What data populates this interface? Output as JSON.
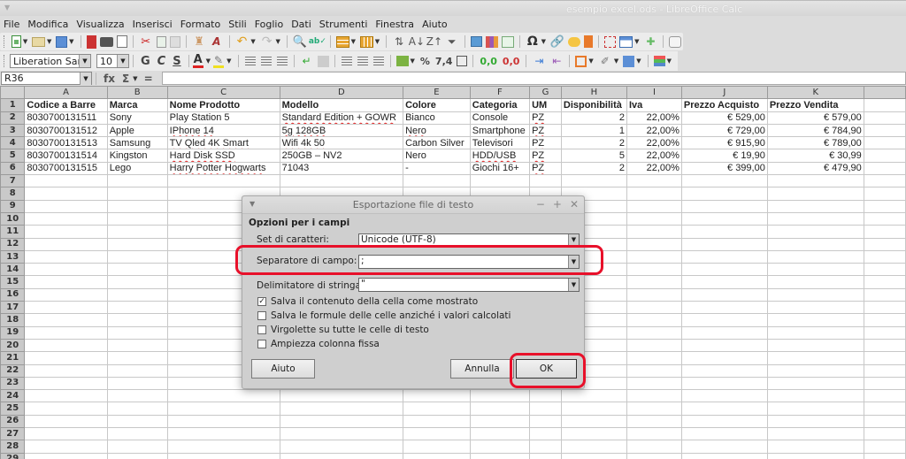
{
  "window": {
    "title": "esempio excel.ods - LibreOffice Calc"
  },
  "menu": [
    {
      "label": "File",
      "key": "F"
    },
    {
      "label": "Modifica",
      "key": "M"
    },
    {
      "label": "Visualizza",
      "key": "V"
    },
    {
      "label": "Inserisci",
      "key": "I"
    },
    {
      "label": "Formato",
      "key": "o"
    },
    {
      "label": "Stili",
      "key": "i"
    },
    {
      "label": "Foglio",
      "key": "F"
    },
    {
      "label": "Dati",
      "key": "D"
    },
    {
      "label": "Strumenti",
      "key": "r"
    },
    {
      "label": "Finestra",
      "key": "n"
    },
    {
      "label": "Aiuto",
      "key": "u"
    }
  ],
  "toolbar_standard_icons": [
    "new-icon",
    "open-icon",
    "save-icon",
    "export-pdf-icon",
    "print-icon",
    "print-preview-icon",
    "cut-icon",
    "copy-icon",
    "paste-icon",
    "clone-formatting-icon",
    "clear-formatting-icon",
    "undo-icon",
    "redo-icon",
    "find-replace-icon",
    "spelling-icon",
    "row-icon",
    "column-icon",
    "sort-icon",
    "sort-ascending-icon",
    "sort-descending-icon",
    "autofilter-icon",
    "insert-image-icon",
    "insert-chart-icon",
    "pivot-table-icon",
    "special-character-icon",
    "hyperlink-icon",
    "comment-icon",
    "headers-footers-icon",
    "print-area-icon",
    "freeze-rows-columns-icon",
    "split-window-icon",
    "shapes-icon"
  ],
  "formatting": {
    "font_name": "Liberation Sans",
    "font_size": "10",
    "bold": "G",
    "italic": "C",
    "underline": "S",
    "font_color": "A",
    "percent": "%",
    "number": "7,4",
    "colors": {
      "font_color": "#dd2222",
      "highlight": "#f0e020"
    }
  },
  "formula_bar": {
    "name_box": "R36",
    "formula": "",
    "fx": "fx",
    "sum": "Σ",
    "equals": "="
  },
  "sheet": {
    "columns": [
      "A",
      "B",
      "C",
      "D",
      "E",
      "F",
      "G",
      "H",
      "I",
      "J",
      "K",
      ""
    ],
    "rows": [
      {
        "n": "1",
        "cells": [
          "Codice a Barre",
          "Marca",
          "Nome Prodotto",
          "Modello",
          "Colore",
          "Categoria",
          "UM",
          "Disponibilità",
          "Iva",
          "Prezzo Acquisto",
          "Prezzo Vendita",
          ""
        ]
      },
      {
        "n": "2",
        "cells": [
          "8030700131511",
          "Sony",
          "Play Station 5",
          "Standard Edition + GOWR",
          "Bianco",
          "Console",
          "PZ",
          "2",
          "22,00%",
          "€ 529,00",
          "€ 579,00",
          ""
        ]
      },
      {
        "n": "3",
        "cells": [
          "8030700131512",
          "Apple",
          "IPhone 14",
          "5g 128GB",
          "Nero",
          "Smartphone",
          "PZ",
          "1",
          "22,00%",
          "€ 729,00",
          "€ 784,90",
          ""
        ]
      },
      {
        "n": "4",
        "cells": [
          "8030700131513",
          "Samsung",
          "TV Qled 4K Smart",
          "Wifi 4k 50",
          "Carbon Silver",
          "Televisori",
          "PZ",
          "2",
          "22,00%",
          "€ 915,90",
          "€ 789,00",
          ""
        ]
      },
      {
        "n": "5",
        "cells": [
          "8030700131514",
          "Kingston",
          "Hard Disk SSD",
          "250GB – NV2",
          "Nero",
          "HDD/USB",
          "PZ",
          "5",
          "22,00%",
          "€ 19,90",
          "€ 30,99",
          ""
        ]
      },
      {
        "n": "6",
        "cells": [
          "8030700131515",
          "Lego",
          "Harry Potter Hogwarts",
          "71043",
          "-",
          "Giochi 16+",
          "PZ",
          "2",
          "22,00%",
          "€ 399,00",
          "€ 479,90",
          ""
        ]
      }
    ],
    "empty_rows": [
      "7",
      "8",
      "9",
      "10",
      "11",
      "12",
      "13",
      "14",
      "15",
      "16",
      "17",
      "18",
      "19",
      "20",
      "21",
      "22",
      "23",
      "24",
      "25",
      "26",
      "27",
      "28",
      "29"
    ]
  },
  "dialog": {
    "title": "Esportazione file di testo",
    "section": "Opzioni per i campi",
    "charset_label": "Set di caratteri:",
    "charset_value": "Unicode (UTF-8)",
    "separator_label": "Separatore di campo:",
    "separator_value": ";",
    "delimiter_label": "Delimitatore di stringa:",
    "delimiter_value": "\"",
    "checkboxes": [
      {
        "label": "Salva il contenuto della cella come mostrato",
        "checked": true
      },
      {
        "label": "Salva le formule delle celle anziché i valori calcolati",
        "checked": false
      },
      {
        "label": "Virgolette su tutte le celle di testo",
        "checked": false
      },
      {
        "label": "Ampiezza colonna fissa",
        "checked": false
      }
    ],
    "help_button": "Aiuto",
    "cancel_button": "Annulla",
    "ok_button": "OK",
    "highlight_color": "#e8102a"
  }
}
